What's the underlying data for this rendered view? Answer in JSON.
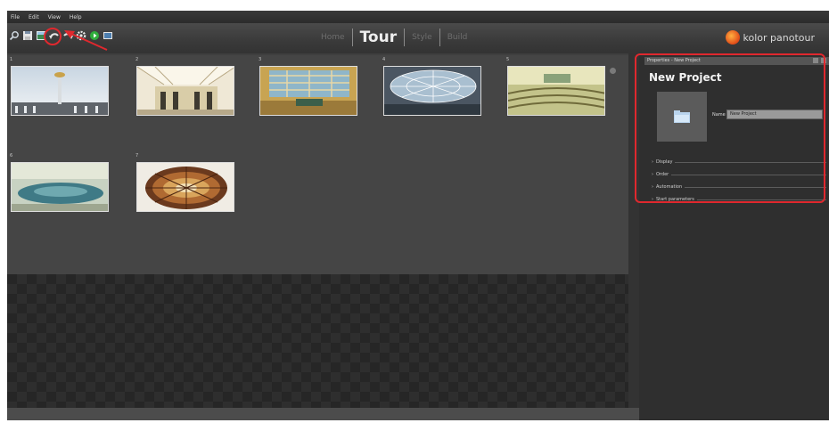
{
  "menu": [
    "File",
    "Edit",
    "View",
    "Help"
  ],
  "toolbar": {
    "icons": [
      "zoom-icon",
      "save-icon",
      "add-panorama-icon",
      "undo-icon",
      "redo-icon",
      "settings-icon",
      "play-icon",
      "image-icon"
    ]
  },
  "tabs": [
    {
      "label": "Home",
      "active": false
    },
    {
      "label": "Tour",
      "active": true
    },
    {
      "label": "Style",
      "active": false
    },
    {
      "label": "Build",
      "active": false
    }
  ],
  "brand": {
    "text": "kolor panotour"
  },
  "thumbnails": [
    "1",
    "2",
    "3",
    "4",
    "5",
    "6",
    "7"
  ],
  "panel": {
    "header": "Properties - New Project",
    "title": "New Project",
    "name_label": "Name",
    "name_value": "New Project",
    "sections": [
      "Display",
      "Order",
      "Automation",
      "Start parameters"
    ]
  },
  "colors": {
    "highlight": "#e0282e",
    "background": "#3f3f3f",
    "panel": "#2f2f2f"
  }
}
